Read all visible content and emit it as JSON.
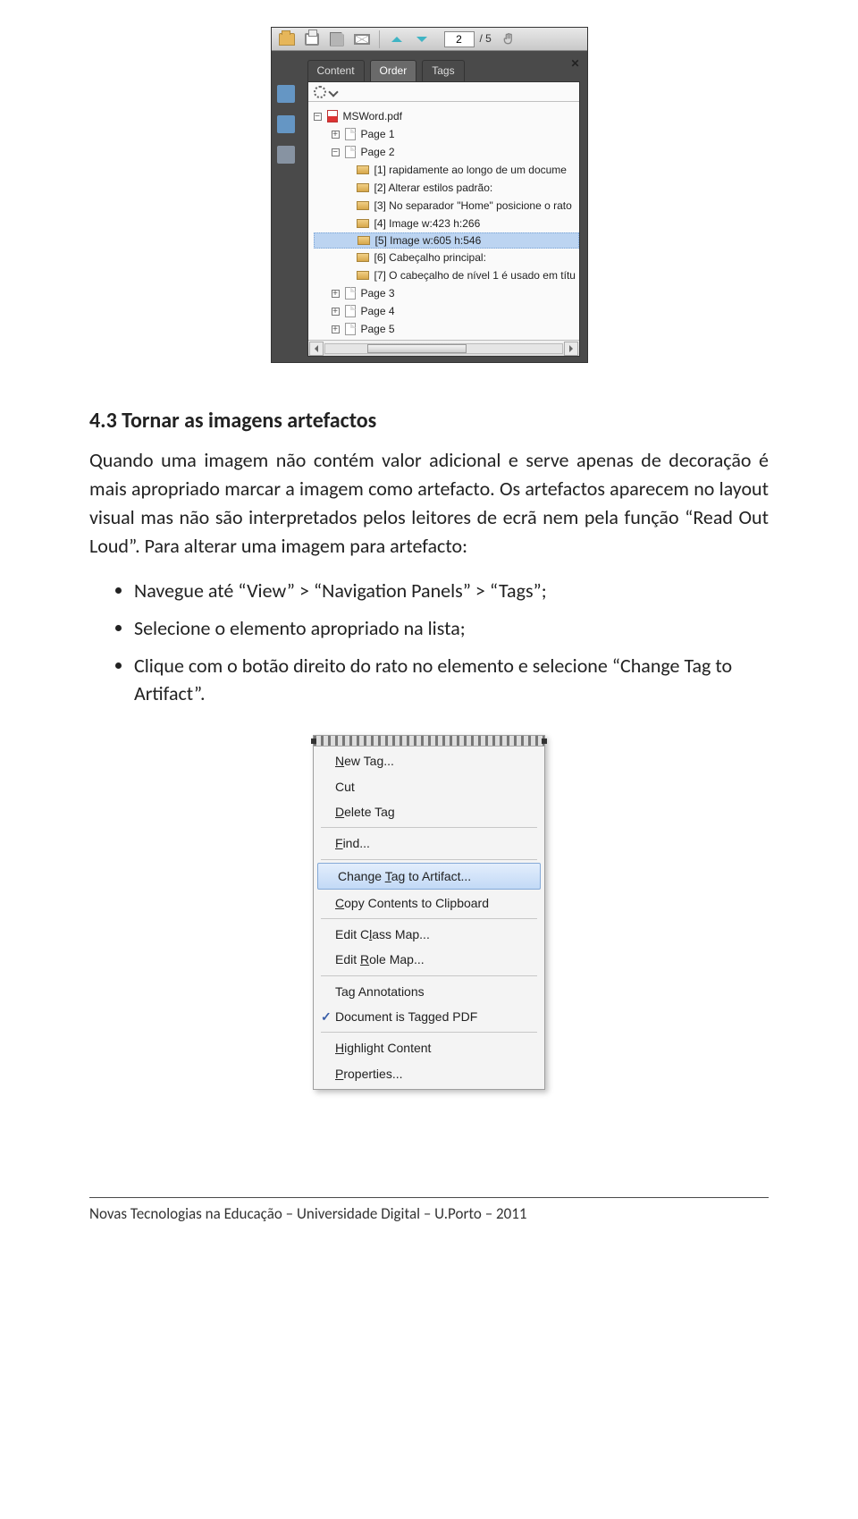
{
  "acrobat": {
    "page_value": "2",
    "page_total": "/ 5",
    "tabs": {
      "content": "Content",
      "order": "Order",
      "tags": "Tags"
    },
    "tree": {
      "root": "MSWord.pdf",
      "page1": "Page 1",
      "page2": "Page 2",
      "page2_items": [
        "[1]  rapidamente ao longo de um docume",
        "[2]  Alterar estilos padrão:",
        "[3]  No separador \"Home\" posicione o rato",
        "[4]  Image   w:423 h:266",
        "[5]  Image   w:605 h:546",
        "[6]  Cabeçalho principal:",
        "[7]  O cabeçalho de nível 1 é usado em títu"
      ],
      "page3": "Page 3",
      "page4": "Page 4",
      "page5": "Page 5"
    }
  },
  "doc": {
    "heading": "4.3 Tornar as imagens artefactos",
    "para": "Quando uma imagem não contém valor adicional e serve apenas de decoração é mais apropriado marcar a imagem como artefacto. Os artefactos aparecem no layout visual mas não são interpretados pelos leitores de ecrã nem pela função “Read Out Loud”. Para alterar uma imagem para artefacto:",
    "bullets": [
      "Navegue até “View” > “Navigation Panels” > “Tags”;",
      "Selecione o elemento apropriado na lista;",
      "Clique com o botão direito do rato no elemento e selecione “Change Tag to Artifact”."
    ]
  },
  "menu": {
    "new_tag": "New Tag...",
    "cut": "Cut",
    "delete_tag": "Delete Tag",
    "find": "Find...",
    "change_to_artifact": "Change Tag to Artifact...",
    "copy_contents": "Copy Contents to Clipboard",
    "edit_class_map": "Edit Class Map...",
    "edit_role_map": "Edit Role Map...",
    "tag_annotations": "Tag Annotations",
    "doc_tagged": "Document is Tagged PDF",
    "highlight_content": "Highlight Content",
    "properties": "Properties..."
  },
  "footer": "Novas Tecnologias na Educação – Universidade Digital – U.Porto – 2011"
}
